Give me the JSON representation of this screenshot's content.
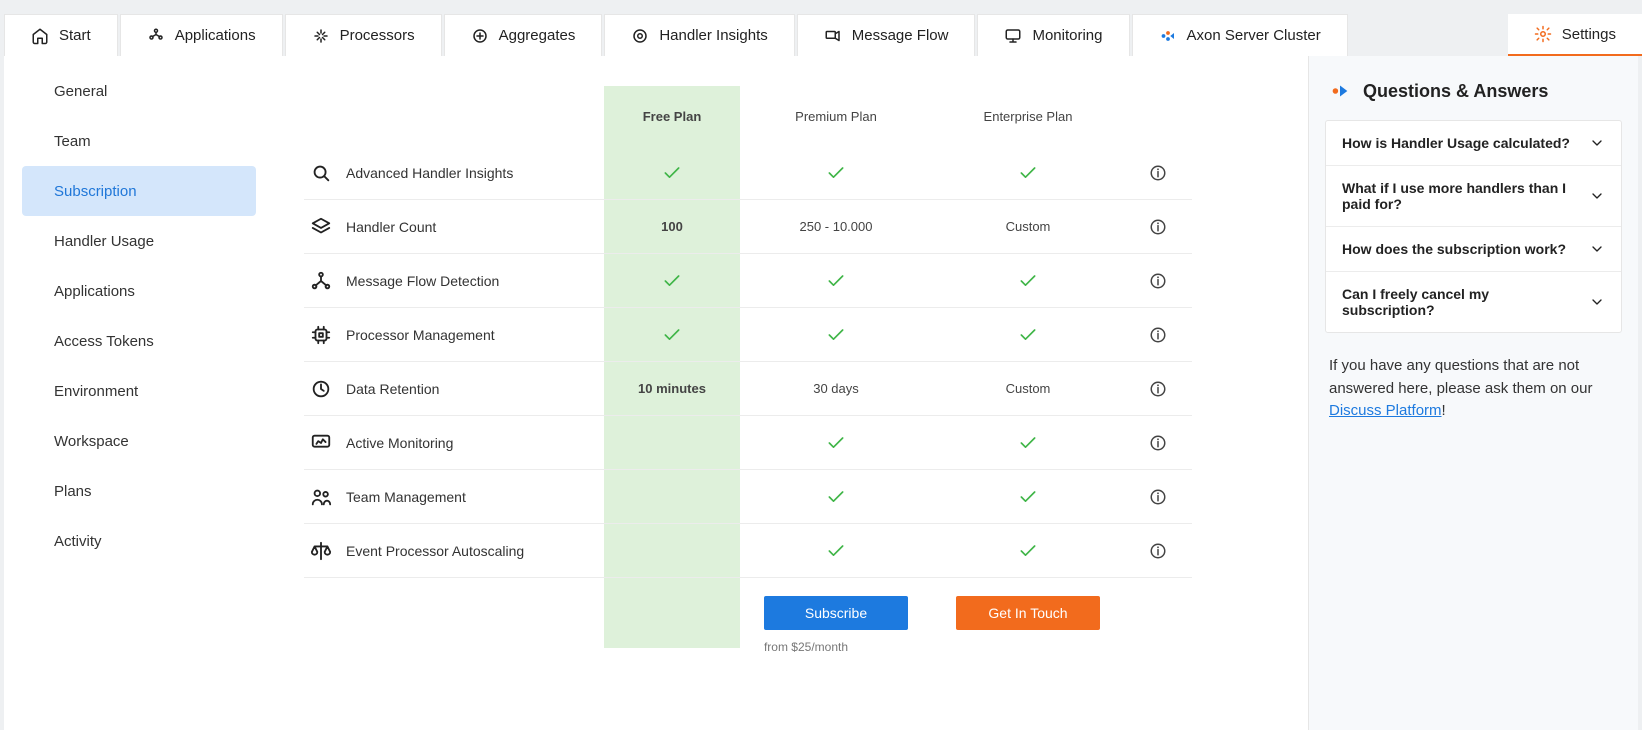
{
  "nav": {
    "tabs": [
      {
        "id": "start",
        "label": "Start",
        "icon": "home"
      },
      {
        "id": "applications",
        "label": "Applications",
        "icon": "apps"
      },
      {
        "id": "processors",
        "label": "Processors",
        "icon": "processors"
      },
      {
        "id": "aggregates",
        "label": "Aggregates",
        "icon": "aggregates"
      },
      {
        "id": "handler-insights",
        "label": "Handler Insights",
        "icon": "insights"
      },
      {
        "id": "message-flow",
        "label": "Message Flow",
        "icon": "flow"
      },
      {
        "id": "monitoring",
        "label": "Monitoring",
        "icon": "monitoring"
      },
      {
        "id": "axon-server-cluster",
        "label": "Axon Server Cluster",
        "icon": "cluster"
      }
    ],
    "settings_label": "Settings"
  },
  "sidebar": {
    "items": [
      "General",
      "Team",
      "Subscription",
      "Handler Usage",
      "Applications",
      "Access Tokens",
      "Environment",
      "Workspace",
      "Plans",
      "Activity"
    ],
    "active_index": 2
  },
  "plans": {
    "columns": [
      "Free Plan",
      "Premium Plan",
      "Enterprise Plan"
    ],
    "rows": [
      {
        "label": "Advanced Handler Insights",
        "icon": "search",
        "free": "check",
        "premium": "check",
        "enterprise": "check"
      },
      {
        "label": "Handler Count",
        "icon": "layers",
        "free": "100",
        "premium": "250 - 10.000",
        "enterprise": "Custom"
      },
      {
        "label": "Message Flow Detection",
        "icon": "flownodes",
        "free": "check",
        "premium": "check",
        "enterprise": "check"
      },
      {
        "label": "Processor Management",
        "icon": "cpu",
        "free": "check",
        "premium": "check",
        "enterprise": "check"
      },
      {
        "label": "Data Retention",
        "icon": "clock",
        "free": "10 minutes",
        "premium": "30 days",
        "enterprise": "Custom"
      },
      {
        "label": "Active Monitoring",
        "icon": "monitor",
        "free": "",
        "premium": "check",
        "enterprise": "check"
      },
      {
        "label": "Team Management",
        "icon": "team",
        "free": "",
        "premium": "check",
        "enterprise": "check"
      },
      {
        "label": "Event Processor Autoscaling",
        "icon": "scale",
        "free": "",
        "premium": "check",
        "enterprise": "check"
      }
    ],
    "cta": {
      "subscribe_label": "Subscribe",
      "subscribe_note": "from $25/month",
      "contact_label": "Get In Touch"
    }
  },
  "qa": {
    "title": "Questions & Answers",
    "items": [
      "How is Handler Usage calculated?",
      "What if I use more handlers than I paid for?",
      "How does the subscription work?",
      "Can I freely cancel my subscription?"
    ],
    "note_pre": "If you have any questions that are not answered here, please ask them on our ",
    "note_link": "Discuss Platform",
    "note_post": "!"
  }
}
